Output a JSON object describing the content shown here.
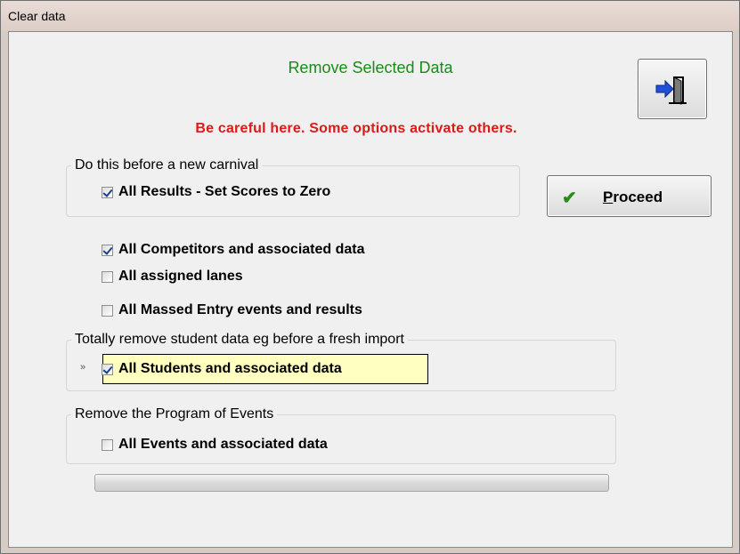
{
  "window": {
    "title": "Clear data"
  },
  "heading": "Remove Selected Data",
  "warning": "Be careful here.  Some options activate others.",
  "buttons": {
    "proceed_prefix": "",
    "proceed_underline": "P",
    "proceed_rest": "roceed",
    "exit_icon": "exit-door-icon",
    "proceed_icon": "checkmark-icon"
  },
  "groups": {
    "new_carnival": {
      "title": "Do this before a new carnival",
      "options": [
        {
          "label": "All Results - Set Scores to Zero",
          "checked": true
        }
      ]
    },
    "ungrouped": {
      "options": [
        {
          "label": "All Competitors and associated data",
          "checked": true
        },
        {
          "label": "All assigned lanes",
          "checked": false
        },
        {
          "label": "All Massed Entry events and results",
          "checked": false
        }
      ]
    },
    "students": {
      "title": "Totally remove student data  eg before a fresh import",
      "options": [
        {
          "label": "All Students and associated data",
          "checked": true
        }
      ]
    },
    "program": {
      "title": "Remove the Program of Events",
      "options": [
        {
          "label": "All Events and associated data",
          "checked": false
        }
      ]
    }
  },
  "progress": {
    "value": 0
  },
  "colors": {
    "heading": "#1a8a1a",
    "warning": "#e01818",
    "highlight": "#ffffc0",
    "check": "#1c3e8e"
  }
}
